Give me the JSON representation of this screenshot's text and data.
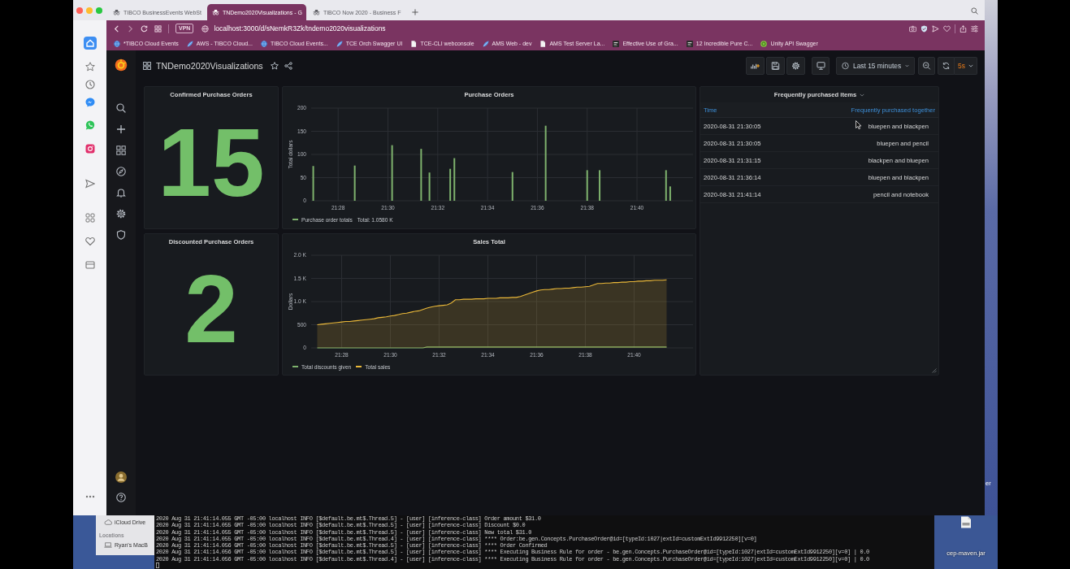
{
  "browser": {
    "tabs": [
      {
        "title": "TIBCO BusinessEvents WebSt",
        "selected": false
      },
      {
        "title": "TNDemo2020Visualizations - G",
        "selected": true
      },
      {
        "title": "TIBCO Now 2020 - Business F",
        "selected": false
      }
    ],
    "vpn_badge": "VPN",
    "url": "localhost:3000/d/sNemkR3Zk/tndemo2020visualizations",
    "bookmarks": [
      {
        "label": "*TIBCO Cloud Events",
        "kind": "globe"
      },
      {
        "label": "AWS - TIBCO Cloud...",
        "kind": "feather"
      },
      {
        "label": "TIBCO Cloud Events...",
        "kind": "globe"
      },
      {
        "label": "TCE Orch Swagger UI",
        "kind": "feather"
      },
      {
        "label": "TCE-CLI webconsole",
        "kind": "page"
      },
      {
        "label": "AMS Web - dev",
        "kind": "feather"
      },
      {
        "label": "AMS Test Server La...",
        "kind": "page"
      },
      {
        "label": "Effective Use of Gra...",
        "kind": "tile"
      },
      {
        "label": "12 Incredible Pure C...",
        "kind": "tile"
      },
      {
        "label": "Unity API Swagger",
        "kind": "circle"
      }
    ]
  },
  "dashboard": {
    "title": "TNDemo2020Visualizations",
    "time_range": "Last 15 minutes",
    "refresh_interval": "5s",
    "stats": [
      {
        "title": "Confirmed Purchase Orders",
        "value": "15"
      },
      {
        "title": "Discounted Purchase Orders",
        "value": "2"
      }
    ],
    "purchase_orders": {
      "legend_total": "Total: 1.0580 K",
      "chart_data": {
        "type": "bar",
        "title": "Purchase Orders",
        "ylabel": "Total dollars",
        "grid": true,
        "categories": [
          null,
          null,
          null,
          null,
          null,
          null,
          "21:28",
          null,
          null,
          null,
          null,
          null,
          null,
          null,
          null,
          null,
          null,
          null,
          "21:30",
          null,
          null,
          null,
          null,
          null,
          null,
          null,
          null,
          null,
          null,
          null,
          "21:32",
          null,
          null,
          null,
          null,
          null,
          null,
          null,
          null,
          null,
          null,
          null,
          "21:34",
          null,
          null,
          null,
          null,
          null,
          null,
          null,
          null,
          null,
          null,
          null,
          "21:36",
          null,
          null,
          null,
          null,
          null,
          null,
          null,
          null,
          null,
          null,
          null,
          "21:38",
          null,
          null,
          null,
          null,
          null,
          null,
          null,
          null,
          null,
          null,
          null,
          "21:40",
          null,
          null,
          null,
          null,
          null,
          null,
          null,
          null,
          null,
          null,
          null,
          null,
          null
        ],
        "series": [
          {
            "name": "Purchase order totals",
            "color": "#7eb26d",
            "values": [
              75,
              null,
              null,
              null,
              null,
              null,
              null,
              null,
              null,
              null,
              76,
              null,
              null,
              null,
              null,
              null,
              null,
              null,
              null,
              120,
              null,
              null,
              null,
              null,
              null,
              null,
              112,
              null,
              61,
              null,
              null,
              null,
              null,
              69,
              92,
              null,
              null,
              null,
              null,
              null,
              null,
              null,
              null,
              null,
              null,
              null,
              null,
              null,
              62,
              null,
              null,
              null,
              null,
              null,
              null,
              null,
              162,
              null,
              null,
              null,
              null,
              null,
              null,
              null,
              null,
              null,
              66,
              null,
              null,
              66,
              null,
              null,
              null,
              null,
              null,
              null,
              null,
              null,
              null,
              null,
              null,
              null,
              null,
              null,
              null,
              66,
              31,
              null,
              null,
              null,
              null,
              null
            ]
          }
        ],
        "ylim": [
          0,
          200
        ],
        "yticks": [
          0,
          50,
          100,
          150,
          200
        ]
      }
    },
    "sales_total": {
      "chart_data": {
        "type": "area",
        "title": "Sales Total",
        "ylabel": "Dollars",
        "grid": true,
        "categories": [
          null,
          null,
          null,
          null,
          null,
          null,
          null,
          "21:28",
          null,
          null,
          null,
          null,
          null,
          null,
          null,
          null,
          null,
          null,
          null,
          "21:30",
          null,
          null,
          null,
          null,
          null,
          null,
          null,
          null,
          null,
          null,
          null,
          "21:32",
          null,
          null,
          null,
          null,
          null,
          null,
          null,
          null,
          null,
          null,
          null,
          "21:34",
          null,
          null,
          null,
          null,
          null,
          null,
          null,
          null,
          null,
          null,
          null,
          "21:36",
          null,
          null,
          null,
          null,
          null,
          null,
          null,
          null,
          null,
          null,
          null,
          "21:38",
          null,
          null,
          null,
          null,
          null,
          null,
          null,
          null,
          null,
          null,
          null,
          "21:40",
          null,
          null,
          null,
          null,
          null,
          null,
          null,
          null,
          null,
          null,
          null,
          null,
          null,
          null
        ],
        "series": [
          {
            "name": "Total discounts given",
            "color": "#7eb26d",
            "values": [
              null,
              0,
              0,
              0,
              0,
              0,
              0,
              0,
              0,
              0,
              0,
              0,
              0,
              0,
              0,
              0,
              0,
              0,
              0,
              0,
              0,
              0,
              0,
              0,
              0,
              0,
              0,
              0,
              20,
              20,
              20,
              20,
              20,
              20,
              20,
              20,
              20,
              20,
              20,
              20,
              20,
              20,
              20,
              20,
              20,
              20,
              20,
              20,
              20,
              20,
              20,
              20,
              20,
              20,
              20,
              20,
              20,
              20,
              20,
              20,
              20,
              20,
              20,
              20,
              20,
              20,
              20,
              20,
              20,
              20,
              20,
              20,
              20,
              20,
              20,
              20,
              20,
              20,
              20,
              20,
              20,
              20,
              20,
              20,
              20,
              20,
              20,
              20,
              null,
              null,
              null,
              null,
              null,
              null
            ]
          },
          {
            "name": "Total sales",
            "color": "#eab839",
            "values": [
              null,
              500,
              510,
              520,
              530,
              540,
              550,
              560,
              570,
              570,
              580,
              590,
              600,
              610,
              620,
              630,
              650,
              660,
              670,
              690,
              700,
              720,
              740,
              750,
              770,
              790,
              800,
              830,
              860,
              880,
              900,
              910,
              920,
              930,
              970,
              1040,
              1040,
              1050,
              1050,
              1050,
              1060,
              1060,
              1060,
              1070,
              1070,
              1070,
              1080,
              1080,
              1080,
              1090,
              1090,
              1110,
              1140,
              1170,
              1200,
              1230,
              1250,
              1260,
              1260,
              1270,
              1280,
              1280,
              1290,
              1290,
              1300,
              1310,
              1310,
              1320,
              1330,
              1360,
              1390,
              1390,
              1400,
              1400,
              1410,
              1410,
              1420,
              1420,
              1430,
              1430,
              1440,
              1440,
              1450,
              1450,
              1460,
              1460,
              1460,
              1470,
              null,
              null,
              null,
              null,
              null,
              null
            ]
          }
        ],
        "ylim": [
          0,
          2000
        ],
        "yticks": [
          {
            "value": 0,
            "label": "0"
          },
          {
            "value": 500,
            "label": "500"
          },
          {
            "value": 1000,
            "label": "1.0 K"
          },
          {
            "value": 1500,
            "label": "1.5 K"
          },
          {
            "value": 2000,
            "label": "2.0 K"
          }
        ]
      }
    },
    "table": {
      "title": "Frequently purchased items",
      "columns": [
        "Time",
        "Frequently purchased together"
      ],
      "rows": [
        [
          "2020-08-31 21:30:05",
          "bluepen and blackpen"
        ],
        [
          "2020-08-31 21:30:05",
          "bluepen and pencil"
        ],
        [
          "2020-08-31 21:31:15",
          "blackpen and bluepen"
        ],
        [
          "2020-08-31 21:36:14",
          "bluepen and blackpen"
        ],
        [
          "2020-08-31 21:41:14",
          "pencil and notebook"
        ]
      ]
    }
  },
  "desktop": {
    "finder_items": [
      {
        "label": "iCloud Drive",
        "kind": "cloud"
      },
      {
        "label": "Locations",
        "kind": "heading"
      },
      {
        "label": "Ryan's MacB",
        "kind": "computer"
      }
    ],
    "terminal_lines": [
      "2020 Aug 31 21:41:14.055 GMT -05:00 localhost INFO [$default.be.mt$.Thread.5] - [user] [inference-class] Order amount $31.0",
      "2020 Aug 31 21:41:14.055 GMT -05:00 localhost INFO [$default.be.mt$.Thread.5] - [user] [inference-class] Discount $0.0",
      "2020 Aug 31 21:41:14.055 GMT -05:00 localhost INFO [$default.be.mt$.Thread.5] - [user] [inference-class] New total $31.0",
      "2020 Aug 31 21:41:14.055 GMT -05:00 localhost INFO [$default.be.mt$.Thread.4] - [user] [inference-class] **** Order:be.gen.Concepts.PurchaseOrder@id=[typeId:1027|extId=customExtId9912250][v=0]",
      "2020 Aug 31 21:41:14.056 GMT -05:00 localhost INFO [$default.be.mt$.Thread.5] - [user] [inference-class] **** Order Confirmed",
      "2020 Aug 31 21:41:14.056 GMT -05:00 localhost INFO [$default.be.mt$.Thread.5] - [user] [inference-class] **** Executing Business Rule for order - be.gen.Concepts.PurchaseOrder@id=[typeId:1027|extId=customExtId9912250][v=0] | 0.0",
      "2020 Aug 31 21:41:14.056 GMT -05:00 localhost INFO [$default.be.mt$.Thread.4] - [user] [inference-class] **** Executing Business Rule for order - be.gen.Concepts.PurchaseOrder@id=[typeId:1027|extId=customExtId9912250][v=0] | 0.0"
    ],
    "file_label": "cep-maven.jar",
    "edge_label": "er"
  }
}
